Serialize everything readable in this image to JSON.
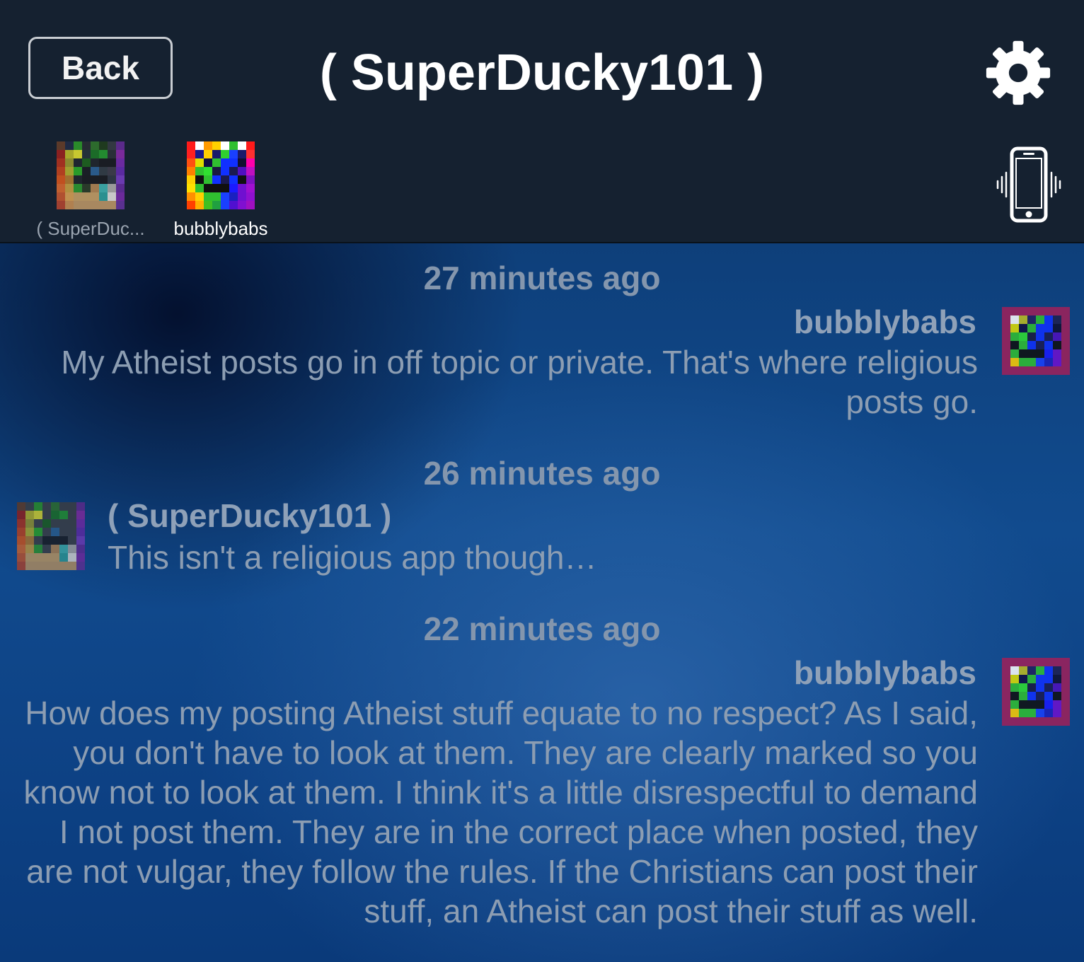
{
  "header": {
    "back_label": "Back",
    "title": "( SuperDucky101 )",
    "settings_icon": "gear-icon",
    "vibrate_icon": "phone-vibrate-icon"
  },
  "participants": [
    {
      "label": "( SuperDuc...",
      "avatar": "pixel-avatar-superducky"
    },
    {
      "label": "bubblybabs",
      "avatar": "pixel-avatar-bubblybabs"
    }
  ],
  "messages": [
    {
      "timestamp": "27 minutes ago",
      "sender": "bubblybabs",
      "side": "right",
      "text": "My Atheist posts go in off topic or private.  That's where religious posts go."
    },
    {
      "timestamp": "26 minutes ago",
      "sender": "( SuperDucky101 )",
      "side": "left",
      "text": "This isn't a religious app though…"
    },
    {
      "timestamp": "22 minutes ago",
      "sender": "bubblybabs",
      "side": "right",
      "text": "How does my posting Atheist stuff equate to no respect?  As I said, you don't have to look at them.  They are clearly marked so you know not to look at them.  I think it's a little disrespectful to demand I not post them.  They are in the correct place when posted, they are not vulgar, they follow the rules.  If the Christians can post their stuff, an Atheist can post their stuff as well."
    }
  ],
  "colors": {
    "header_bg": "#152130",
    "chat_bg": "#114b8e",
    "timestamp": "#8496ad",
    "message_text": "#8c9db2"
  }
}
